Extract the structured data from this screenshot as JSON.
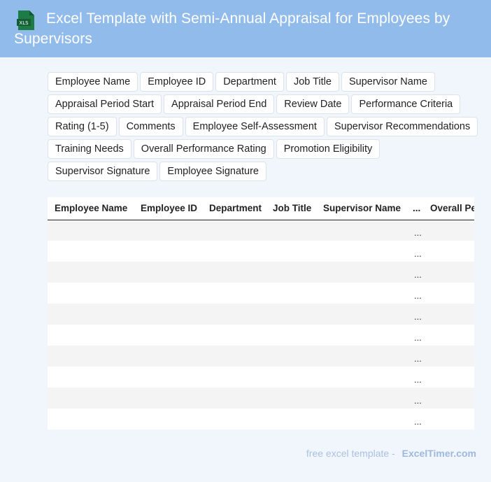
{
  "header": {
    "title": "Excel Template with Semi-Annual Appraisal for Employees by Supervisors",
    "icon": "xls-file-icon",
    "icon_label": "XLS",
    "background": "#91bbea",
    "icon_color": "#1e7b45"
  },
  "fields": {
    "rows": [
      [
        "Employee Name",
        "Employee ID",
        "Department",
        "Job Title",
        "Supervisor Name"
      ],
      [
        "Appraisal Period Start",
        "Appraisal Period End",
        "Review Date",
        "Performance Criteria"
      ],
      [
        "Rating (1-5)",
        "Comments",
        "Employee Self-Assessment",
        "Supervisor Recommendations"
      ],
      [
        "Training Needs",
        "Overall Performance Rating",
        "Promotion Eligibility"
      ],
      [
        "Supervisor Signature",
        "Employee Signature"
      ]
    ]
  },
  "table": {
    "columns": [
      "Employee Name",
      "Employee ID",
      "Department",
      "Job Title",
      "Supervisor Name",
      "...",
      "Overall Performance Rating"
    ],
    "ellipsis": "...",
    "empty_row_count": 10
  },
  "footer": {
    "text": "free excel template -",
    "brand": "ExcelTimer.com"
  }
}
